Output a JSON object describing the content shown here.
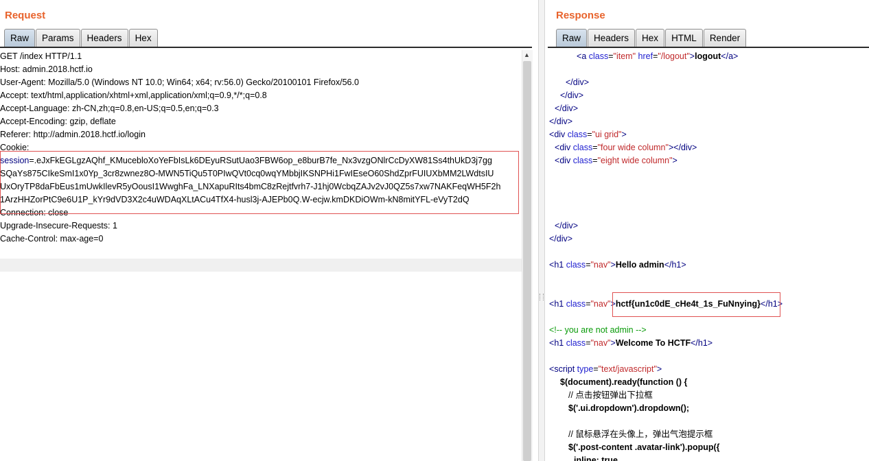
{
  "request": {
    "title": "Request",
    "tabs": [
      "Raw",
      "Params",
      "Headers",
      "Hex"
    ],
    "active_tab": "Raw",
    "lines": [
      "GET /index HTTP/1.1",
      "Host: admin.2018.hctf.io",
      "User-Agent: Mozilla/5.0 (Windows NT 10.0; Win64; x64; rv:56.0) Gecko/20100101 Firefox/56.0",
      "Accept: text/html,application/xhtml+xml,application/xml;q=0.9,*/*;q=0.8",
      "Accept-Language: zh-CN,zh;q=0.8,en-US;q=0.5,en;q=0.3",
      "Accept-Encoding: gzip, deflate",
      "Referer: http://admin.2018.hctf.io/login",
      "Cookie:"
    ],
    "session_key": "session",
    "session_lines": [
      "=.eJxFkEGLgzAQhf_KMucebloXoYeFbIsLk6DEyuRSutUao3FBW6op_e8burB7fe_Nx3vzgONlrCcDyXW81Ss4thUkD3j7gg",
      "SQaYs875CIkeSmI1x0Yp_3cr8zwnez8O-MWN5TiQu5T0PIwQVt0cq0wqYMbbjIKSNPHi1FwIEseO60ShdZprFUIUXbMM2LWdtsIU",
      "UxOryTP8daFbEus1mUwkIlevR5yOousI1WwghFa_LNXapuRIts4bmC8zRejtfvrh7-J1hj0WcbqZAJv2vJ0QZ5s7xw7NAKFeqWH5F2h",
      "1ArzHHZorPtC9e6U1P_kYr9dVD3X2c4uWDAqXLtACu4TfX4-husl3j-AJEPb0Q.W-ecjw.kmDKDiOWm-kN8mitYFL-eVyT2dQ"
    ],
    "tail_lines": [
      "Connection: close",
      "Upgrade-Insecure-Requests: 1",
      "Cache-Control: max-age=0"
    ]
  },
  "response": {
    "title": "Response",
    "tabs": [
      "Raw",
      "Headers",
      "Hex",
      "HTML",
      "Render"
    ],
    "active_tab": "Raw",
    "t": {
      "lt": "<",
      "gt": ">",
      "ltslash": "</",
      "eq": "=",
      "a": "a",
      "div": "div",
      "h1": "h1",
      "script": "script",
      "class": "class",
      "href": "href",
      "type": "type",
      "q_item": "\"item\"",
      "q_logout": "\"/logout\"",
      "logout_text": "logout",
      "q_ui_grid": "\"ui grid\"",
      "q_four": "\"four wide column\"",
      "q_eight": "\"eight wide column\"",
      "q_nav": "\"nav\"",
      "hello": "Hello admin",
      "flag": "hctf{un1c0dE_cHe4t_1s_FuNnying}",
      "comment": "<!-- you are not admin -->",
      "welcome": "Welcome To HCTF",
      "q_js": "\"text/javascript\"",
      "js1": "$(document).ready(function () {",
      "js2": "// 点击按钮弹出下拉框",
      "js3": "$('.ui.dropdown').dropdown();",
      "js4": "// 鼠标悬浮在头像上，弹出气泡提示框",
      "js5": "$('.post-content .avatar-link').popup({",
      "js6": "inline: true,"
    }
  }
}
